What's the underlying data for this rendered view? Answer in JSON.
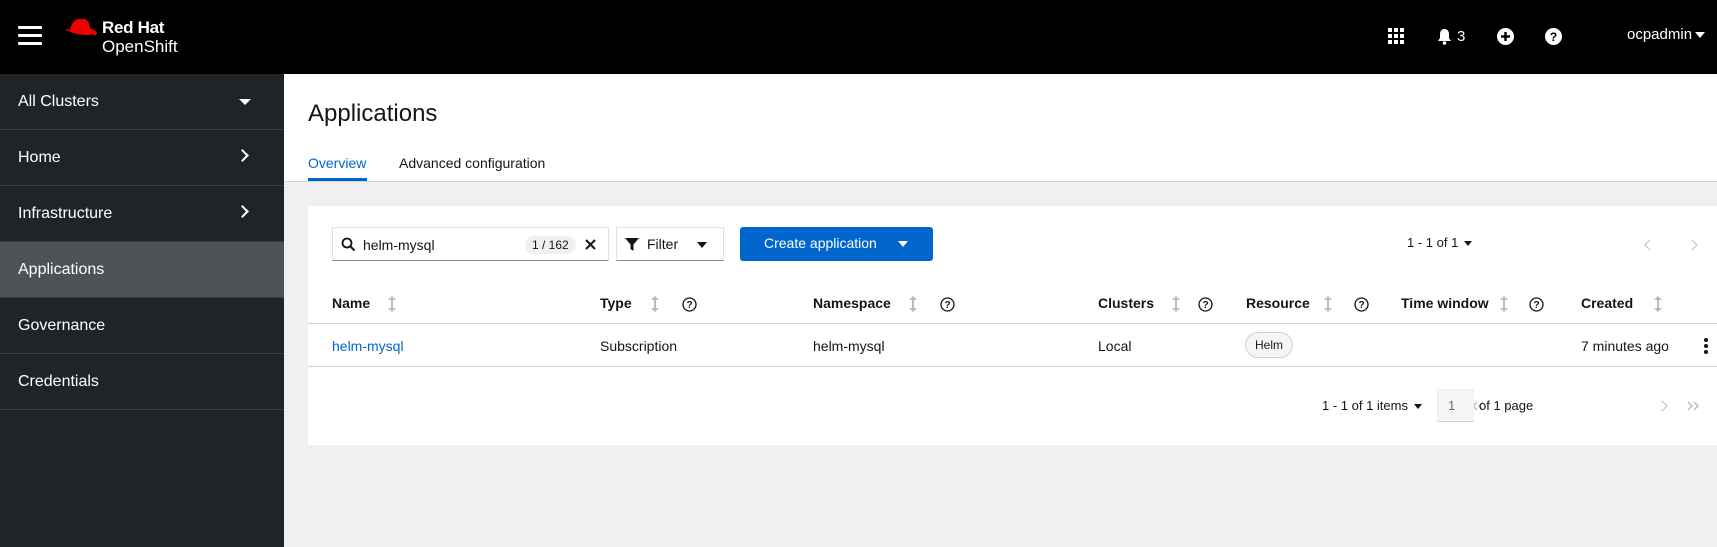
{
  "masthead": {
    "brand_line1": "Red Hat",
    "brand_line2": "OpenShift",
    "notifications_count": "3",
    "user": "ocpadmin"
  },
  "sidebar": {
    "items": [
      {
        "label": "All Clusters",
        "indicator": "dropdown"
      },
      {
        "label": "Home",
        "indicator": "chevron-right"
      },
      {
        "label": "Infrastructure",
        "indicator": "chevron-right"
      },
      {
        "label": "Applications",
        "active": true
      },
      {
        "label": "Governance"
      },
      {
        "label": "Credentials"
      }
    ]
  },
  "page": {
    "title": "Applications",
    "tabs": [
      {
        "label": "Overview",
        "active": true
      },
      {
        "label": "Advanced configuration"
      }
    ]
  },
  "toolbar": {
    "search_value": "helm-mysql",
    "search_count": "1 / 162",
    "filter_label": "Filter",
    "create_label": "Create application",
    "pagination_summary": "1 - 1 of 1"
  },
  "table": {
    "columns": [
      "Name",
      "Type",
      "Namespace",
      "Clusters",
      "Resource",
      "Time window",
      "Created"
    ],
    "rows": [
      {
        "name": "helm-mysql",
        "type": "Subscription",
        "namespace": "helm-mysql",
        "clusters": "Local",
        "resource": "Helm",
        "time_window": "",
        "created": "7 minutes ago"
      }
    ]
  },
  "pagination": {
    "items_summary": "1 - 1 of 1 items",
    "current_page": "1",
    "of_pages": "of 1 page"
  },
  "colors": {
    "masthead_bg": "#000000",
    "sidebar_bg": "#212427",
    "sidebar_active": "#4f5255",
    "accent": "#0066cc"
  }
}
